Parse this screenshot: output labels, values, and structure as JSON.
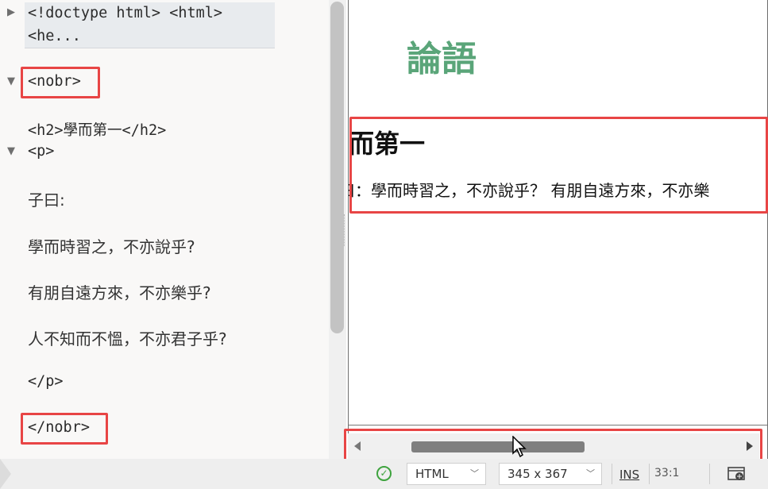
{
  "code_tree": {
    "doctype_line1": "<!doctype html> <html>",
    "doctype_line2": "<he...",
    "nobr_open": "<nobr>",
    "h2_line": "<h2>學而第一</h2>",
    "p_open": "<p>",
    "line_ziyue": "子曰:",
    "line_1": "學而時習之，不亦說乎?",
    "line_2": "有朋自遠方來，不亦樂乎?",
    "line_3": "人不知而不慍，不亦君子乎?",
    "p_close": "</p>",
    "nobr_close": "</nobr>"
  },
  "preview": {
    "title": "論語",
    "h2_visible": "而第一",
    "paragraph_visible": "曰：學而時習之，不亦說乎？ 有朋自遠方來，不亦樂"
  },
  "statusbar": {
    "language": "HTML",
    "viewport_size": "345 x 367",
    "insert_mode": "INS",
    "cursor_position": "33:1"
  },
  "colors": {
    "title_green": "#5aa579",
    "highlight_red": "#e84545",
    "ok_green": "#3ea33e"
  }
}
